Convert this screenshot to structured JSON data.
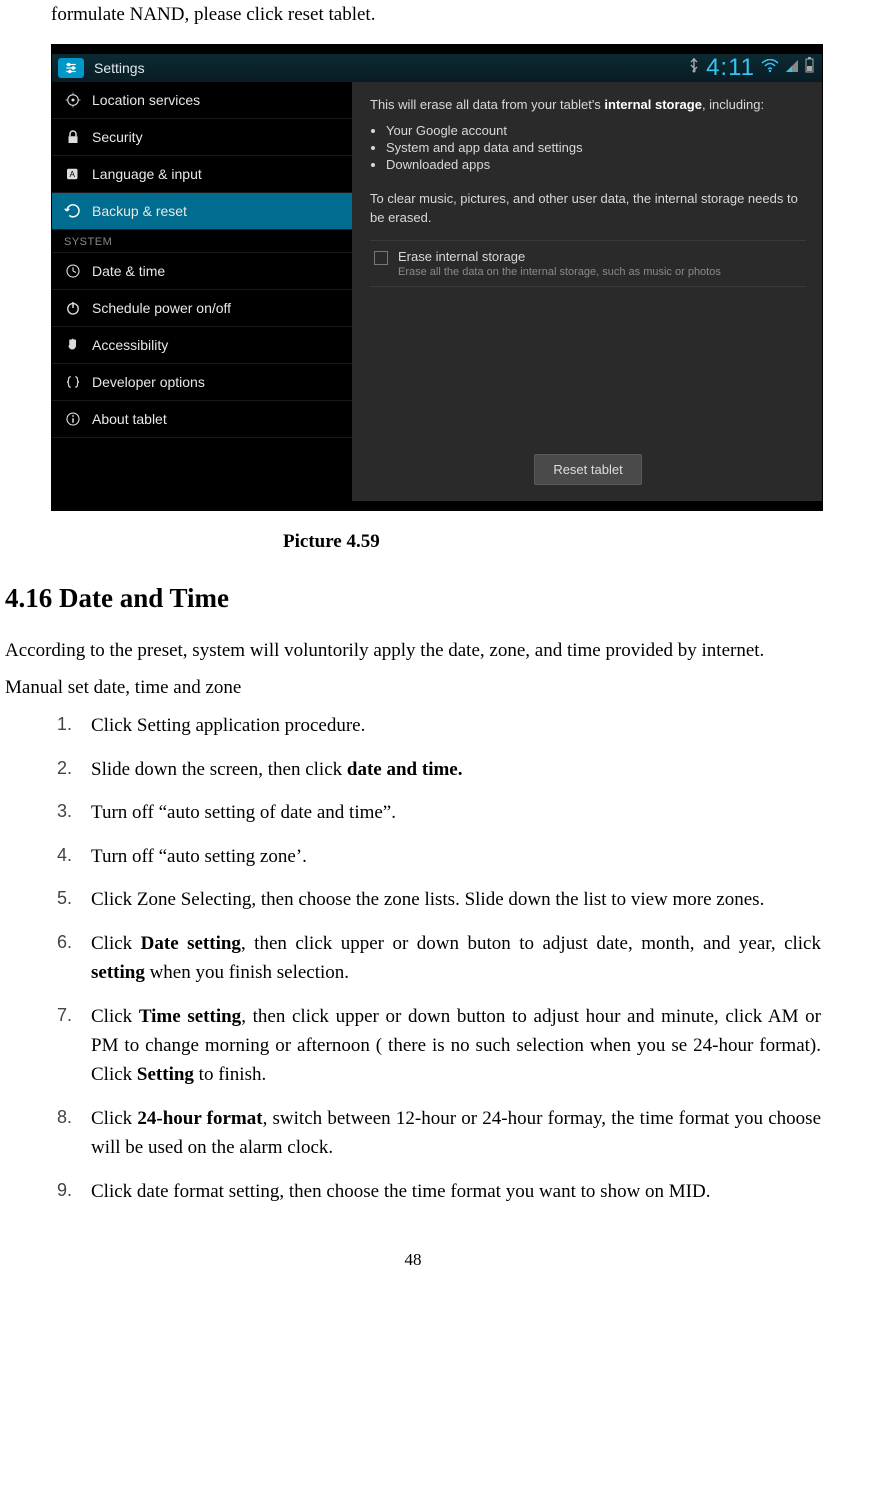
{
  "intro_line": "formulate NAND, please click reset tablet.",
  "screenshot": {
    "statusbar": {
      "title": "Settings",
      "time": "4:11"
    },
    "sidebar": {
      "items": [
        {
          "label": "Location services"
        },
        {
          "label": "Security"
        },
        {
          "label": "Language & input"
        },
        {
          "label": "Backup & reset"
        },
        {
          "label": "Date & time"
        },
        {
          "label": "Schedule power on/off"
        },
        {
          "label": "Accessibility"
        },
        {
          "label": "Developer options"
        },
        {
          "label": "About tablet"
        }
      ],
      "section_label": "SYSTEM"
    },
    "main": {
      "line1_a": "This will erase all data from your tablet's ",
      "line1_b": "internal storage",
      "line1_c": ", including:",
      "bullets": [
        "Your Google account",
        "System and app data and settings",
        "Downloaded apps"
      ],
      "clear_text": "To clear music, pictures, and other user data, the internal storage needs to be erased.",
      "erase_title": "Erase internal storage",
      "erase_sub": "Erase all the data on the internal storage, such as music or photos",
      "reset_button": "Reset tablet"
    }
  },
  "caption": "Picture 4.59",
  "section_heading": "4.16 Date and Time",
  "paragraph1": "According to the preset, system will voluntorily apply the date, zone, and time provided by internet.",
  "subheading": "Manual set date, time and zone",
  "steps": {
    "s1": "Click Setting application procedure.",
    "s2a": "Slide down the screen, then click ",
    "s2b": "date and time.",
    "s3": "Turn off “auto setting of date and time”.",
    "s4": "Turn off “auto setting zone’.",
    "s5": "Click Zone Selecting, then choose the zone lists. Slide down the list to view more zones.",
    "s6a": "Click ",
    "s6b": "Date setting",
    "s6c": ", then click upper or down buton to adjust date, month, and year, click ",
    "s6d": "setting",
    "s6e": " when you finish selection.",
    "s7a": "Click ",
    "s7b": "Time setting",
    "s7c": ", then click upper or down button to adjust hour and minute, click AM or PM to change morning or afternoon ( there is no such selection when you se 24-hour format). Click ",
    "s7d": "Setting",
    "s7e": " to finish.",
    "s8a": "Click ",
    "s8b": "24-hour format",
    "s8c": ", switch between 12-hour or 24-hour formay, the time format you choose will be used on the alarm clock.",
    "s9": "Click date format setting, then choose the time format you want to show on MID."
  },
  "page_number": "48"
}
